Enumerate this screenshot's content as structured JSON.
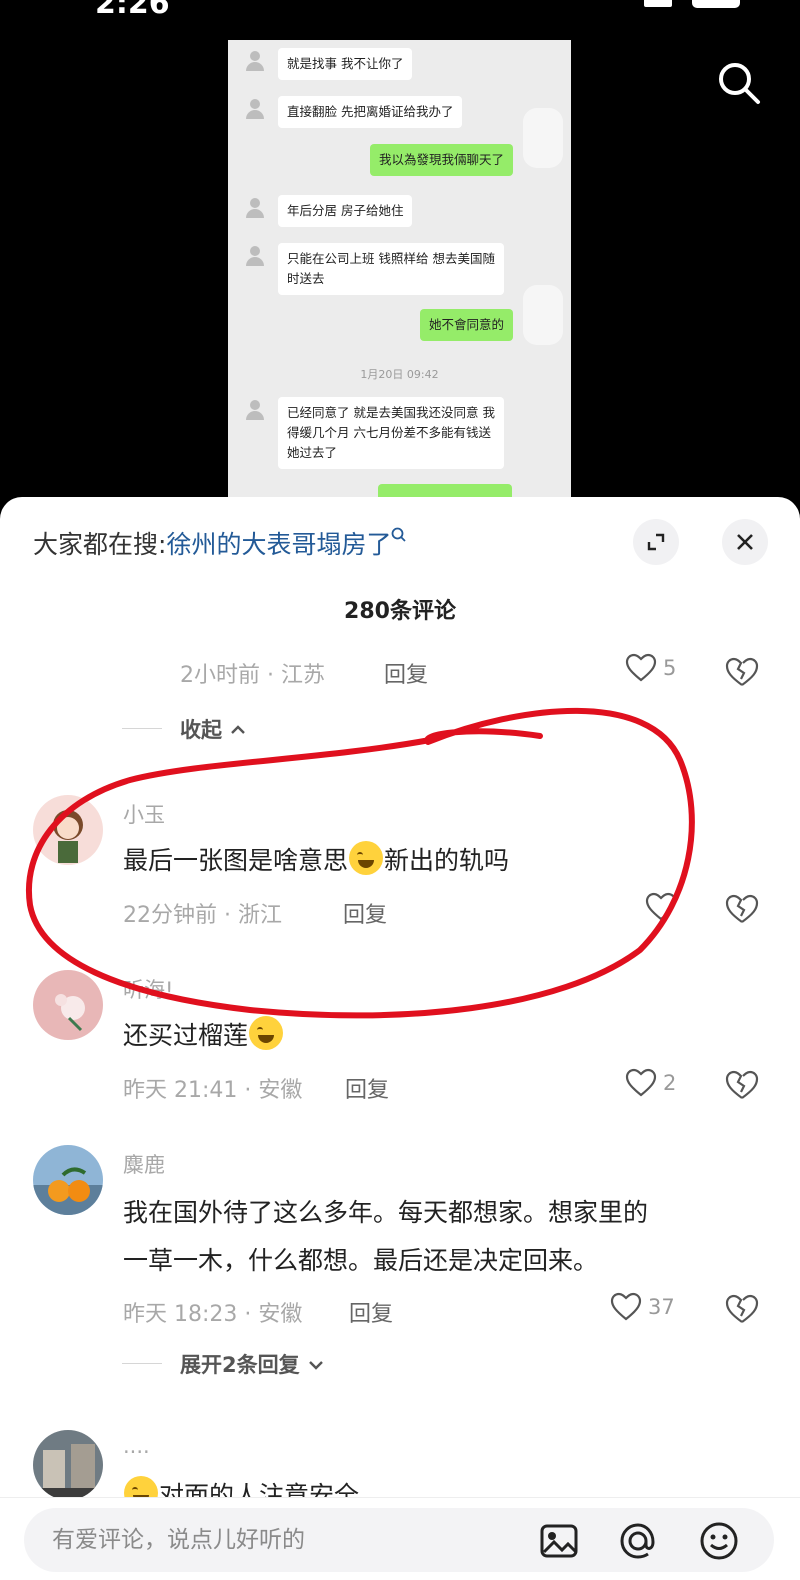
{
  "status_bar": {
    "time": "2:26",
    "battery": "76"
  },
  "video": {
    "search_icon": "search-icon",
    "chat_screenshot": {
      "messages": [
        {
          "side": "left",
          "text": "就是找事 我不让你了"
        },
        {
          "side": "left",
          "text": "直接翻脸 先把离婚证给我办了"
        },
        {
          "side": "right",
          "text": "我以為發現我倆聊天了"
        },
        {
          "side": "left",
          "text": "年后分居 房子给她住"
        },
        {
          "side": "left",
          "text": "只能在公司上班 钱照样给 想去美国随时送去"
        },
        {
          "side": "right",
          "text": "她不會同意的"
        },
        {
          "side": "left",
          "text": "已经同意了 就是去美国我还没同意 我得缓几个月 六七月份差不多能有钱送她过去了"
        }
      ],
      "timestamp": "1月20日 09:42"
    }
  },
  "sheet": {
    "hot_search_prefix": "大家都在搜:",
    "hot_search_term": "徐州的大表哥塌房了",
    "expand_icon": "expand-icon",
    "close_icon": "close-icon",
    "comment_count": "280条评论"
  },
  "prev_reply": {
    "meta": "2小时前 · 江苏",
    "reply": "回复",
    "likes": "5"
  },
  "collapse_label": "收起",
  "comments": [
    {
      "user": "小玉",
      "text_before": "最后一张图是啥意思",
      "text_after": "新出的轨吗",
      "emoji": "crying-laughing-emoji",
      "meta": "22分钟前 · 浙江",
      "reply": "回复",
      "likes": ""
    },
    {
      "user": "听海!",
      "text_before": "还买过榴莲",
      "text_after": "",
      "emoji": "crying-emoji",
      "meta": "昨天 21:41 · 安徽",
      "reply": "回复",
      "likes": "2"
    },
    {
      "user": "麋鹿",
      "line1": "我在国外待了这么多年。每天都想家。想家里的",
      "line2": "一草一木，什么都想。最后还是决定回来。",
      "meta": "昨天 18:23 · 安徽",
      "reply": "回复",
      "likes": "37"
    },
    {
      "user": "....",
      "text_after": "对面的人注意安全",
      "emoji": "worried-emoji"
    }
  ],
  "expand_replies_label": "展开2条回复",
  "input": {
    "placeholder": "有爱评论，说点儿好听的",
    "icons": [
      "image-icon",
      "at-icon",
      "emoji-icon"
    ]
  },
  "colors": {
    "accent_link": "#235a97",
    "wechat_green": "#95ec69",
    "annotation_red": "#e0101e"
  }
}
